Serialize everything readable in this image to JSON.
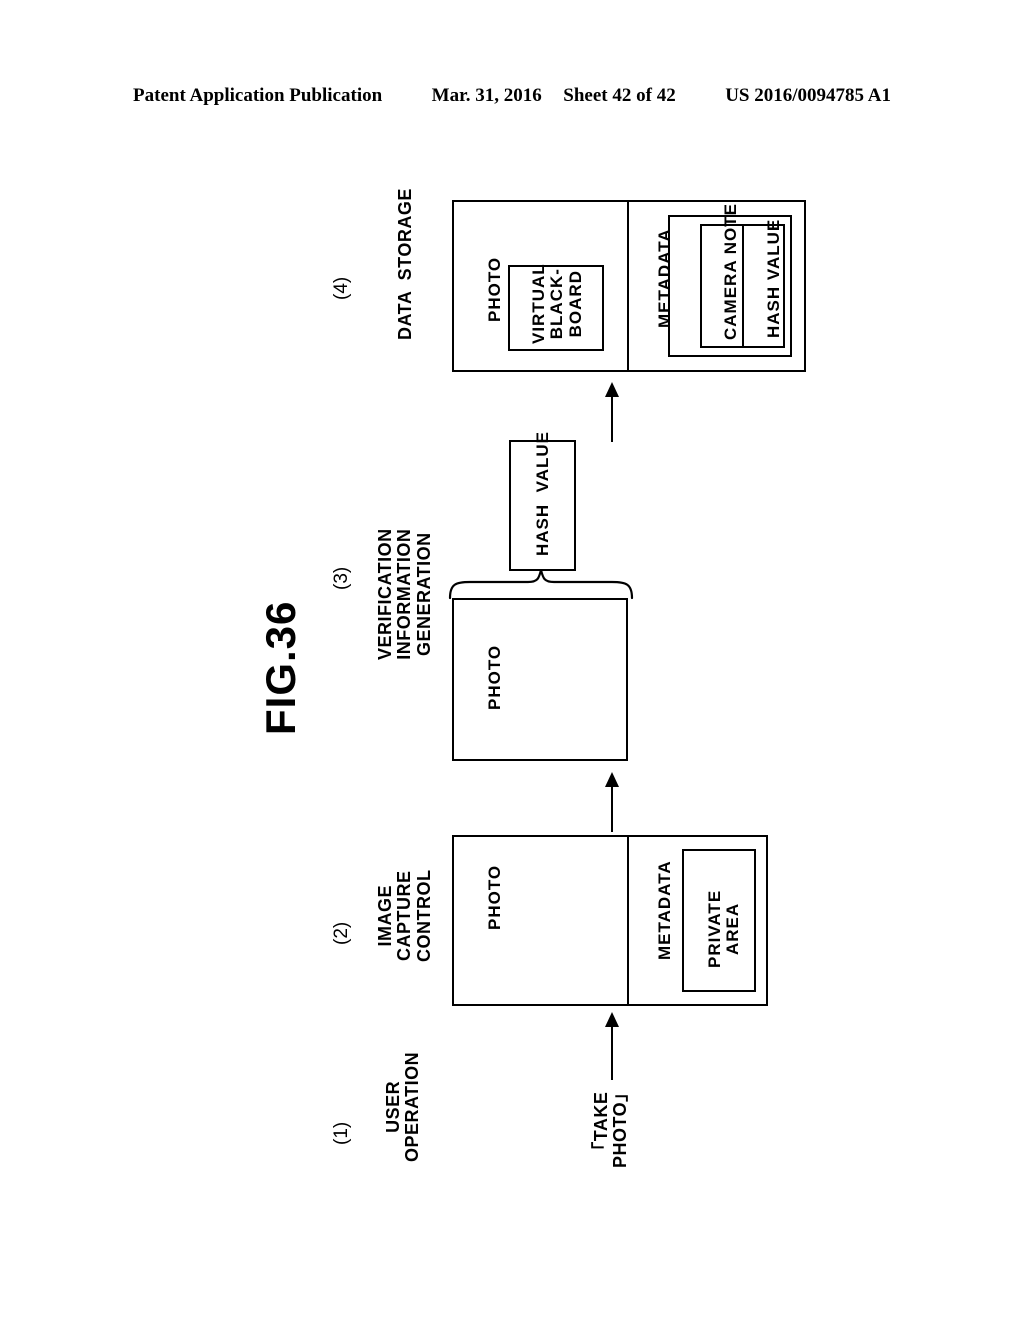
{
  "header": {
    "publication": "Patent Application Publication",
    "date": "Mar. 31, 2016",
    "sheet": "Sheet 42 of 42",
    "patent_number": "US 2016/0094785 A1"
  },
  "figure": {
    "title": "FIG.36",
    "steps": [
      {
        "index": "(1)",
        "label": "USER\nOPERATION",
        "operation_label": "「TAKE\nPHOTO」"
      },
      {
        "index": "(2)",
        "label": "IMAGE\nCAPTURE\nCONTROL",
        "photo_label": "PHOTO",
        "metadata_label": "METADATA",
        "metadata_items": [
          "PRIVATE\nAREA"
        ]
      },
      {
        "index": "(3)",
        "label": "VERIFICATION\nINFORMATION\nGENERATION",
        "photo_label": "PHOTO",
        "hash_label": "HASH  VALUE"
      },
      {
        "index": "(4)",
        "label": "DATA  STORAGE",
        "photo_label": "PHOTO",
        "photo_items": [
          "VIRTUAL\nBLACK-\nBOARD"
        ],
        "metadata_label": "METADATA",
        "metadata_items": [
          "CAMERA NOTE",
          "HASH VALUE"
        ]
      }
    ]
  },
  "colors": {
    "ink": "#000000",
    "paper": "#ffffff"
  }
}
